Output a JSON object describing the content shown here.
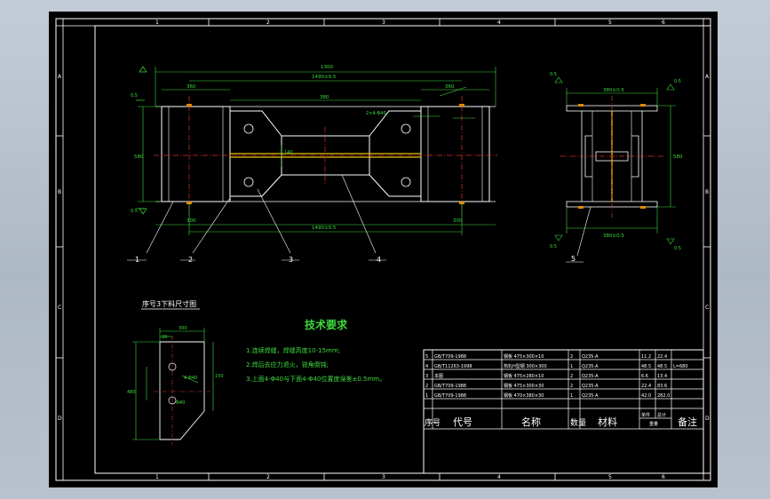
{
  "drawing": {
    "background": "#000000",
    "frame_color": "#ffffff",
    "dim_color": "#3ddc3d",
    "text_color": "#ffffff"
  },
  "border": {
    "columns": [
      "1",
      "2",
      "3",
      "4",
      "5",
      "6"
    ],
    "rows": [
      "A",
      "B",
      "C",
      "D",
      "E",
      "F"
    ]
  },
  "front_view": {
    "overall_dim": "1300",
    "hole_pitch_top": "1490±0.5",
    "hole_pitch_bottom": "1490±0.5",
    "hole_spec": "2×4-Φ40",
    "end_width_left": "360",
    "end_width_right": "360",
    "center_dim": "380",
    "bottom_dim_left": "300",
    "bottom_dim_right": "300",
    "height_dim": "580",
    "web_dim": "140",
    "side_marks": [
      "0.5",
      "0.5",
      "0.5",
      "0.5"
    ]
  },
  "side_view": {
    "top_dim": "380±0.5",
    "bottom_dim": "380±0.5",
    "height_dim": "580",
    "side_marks": [
      "0.5",
      "0.5",
      "0.5",
      "0.5"
    ]
  },
  "callouts": [
    "1",
    "2",
    "3",
    "4",
    "5"
  ],
  "detail": {
    "title": "序号3下料尺寸图",
    "dim_top": "300",
    "dim_top_inner": "20",
    "dim_left": "480",
    "dim_mid": "150",
    "dim_bottom": "Φ40",
    "hole_label": "4-Φ40"
  },
  "tech_requirements": {
    "title": "技术要求",
    "items": [
      "1.连续焊缝，焊缝高度10-15mm;",
      "2.焊后去应力退火，锐角倒钝;",
      "3.上面4-Φ40与下面4-Φ40位置度误差±0.5mm。"
    ]
  },
  "bom": {
    "headers": [
      "序号",
      "代号",
      "名称",
      "数量",
      "材料",
      "单件",
      "总计",
      "备注"
    ],
    "weight_label": "重量",
    "rows": [
      [
        "5",
        "GB/T709-1988",
        "钢板 475×300×10",
        "2",
        "Q235-A",
        "11.2",
        "22.4",
        ""
      ],
      [
        "4",
        "GB/T11263-1998",
        "热轧H型钢 300×300",
        "1",
        "Q235-A",
        "48.5",
        "48.5",
        "L=680"
      ],
      [
        "3",
        "本图",
        "钢板 475×280×10",
        "2",
        "Q235-A",
        "6.6",
        "13.4",
        ""
      ],
      [
        "2",
        "GB/T709-1988",
        "钢板 475×300×30",
        "2",
        "Q235-A",
        "22.4",
        "83.6",
        ""
      ],
      [
        "1",
        "GB/T709-1988",
        "钢板 470×380×30",
        "1",
        "Q235-A",
        "42.0",
        "282.0",
        ""
      ]
    ]
  }
}
